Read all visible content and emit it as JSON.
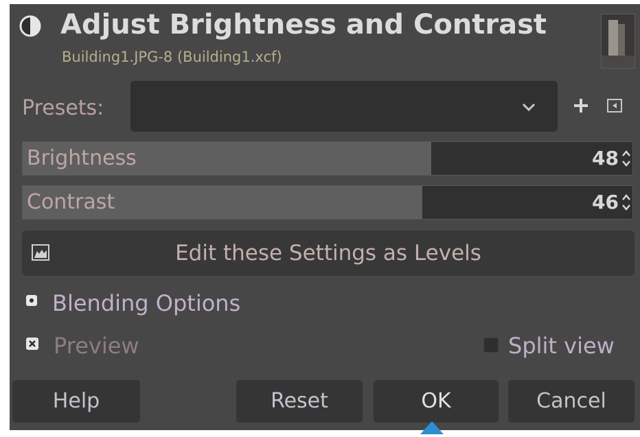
{
  "dialog": {
    "title": "Adjust Brightness and Contrast",
    "subtitle": "Building1.JPG-8 (Building1.xcf)"
  },
  "presets": {
    "label": "Presets:",
    "value": "",
    "add_icon": "plus-icon",
    "manage_icon": "presets-menu-icon"
  },
  "sliders": [
    {
      "label": "Brightness",
      "value": "48",
      "fill_fraction": 0.67
    },
    {
      "label": "Contrast",
      "value": "46",
      "fill_fraction": 0.655
    }
  ],
  "levels_button": {
    "label": "Edit these Settings as Levels",
    "icon": "levels-icon"
  },
  "blending": {
    "label": "Blending Options",
    "expanded": false
  },
  "preview": {
    "label": "Preview",
    "checked": true
  },
  "split_view": {
    "label": "Split view",
    "checked": false
  },
  "buttons": {
    "help": "Help",
    "reset": "Reset",
    "ok": "OK",
    "cancel": "Cancel"
  },
  "colors": {
    "dialog_bg": "#474747",
    "field_bg": "#303030",
    "slider_fill": "#5f5f5f",
    "accent": "#2c8fd4",
    "subtitle": "#b6b08e"
  }
}
